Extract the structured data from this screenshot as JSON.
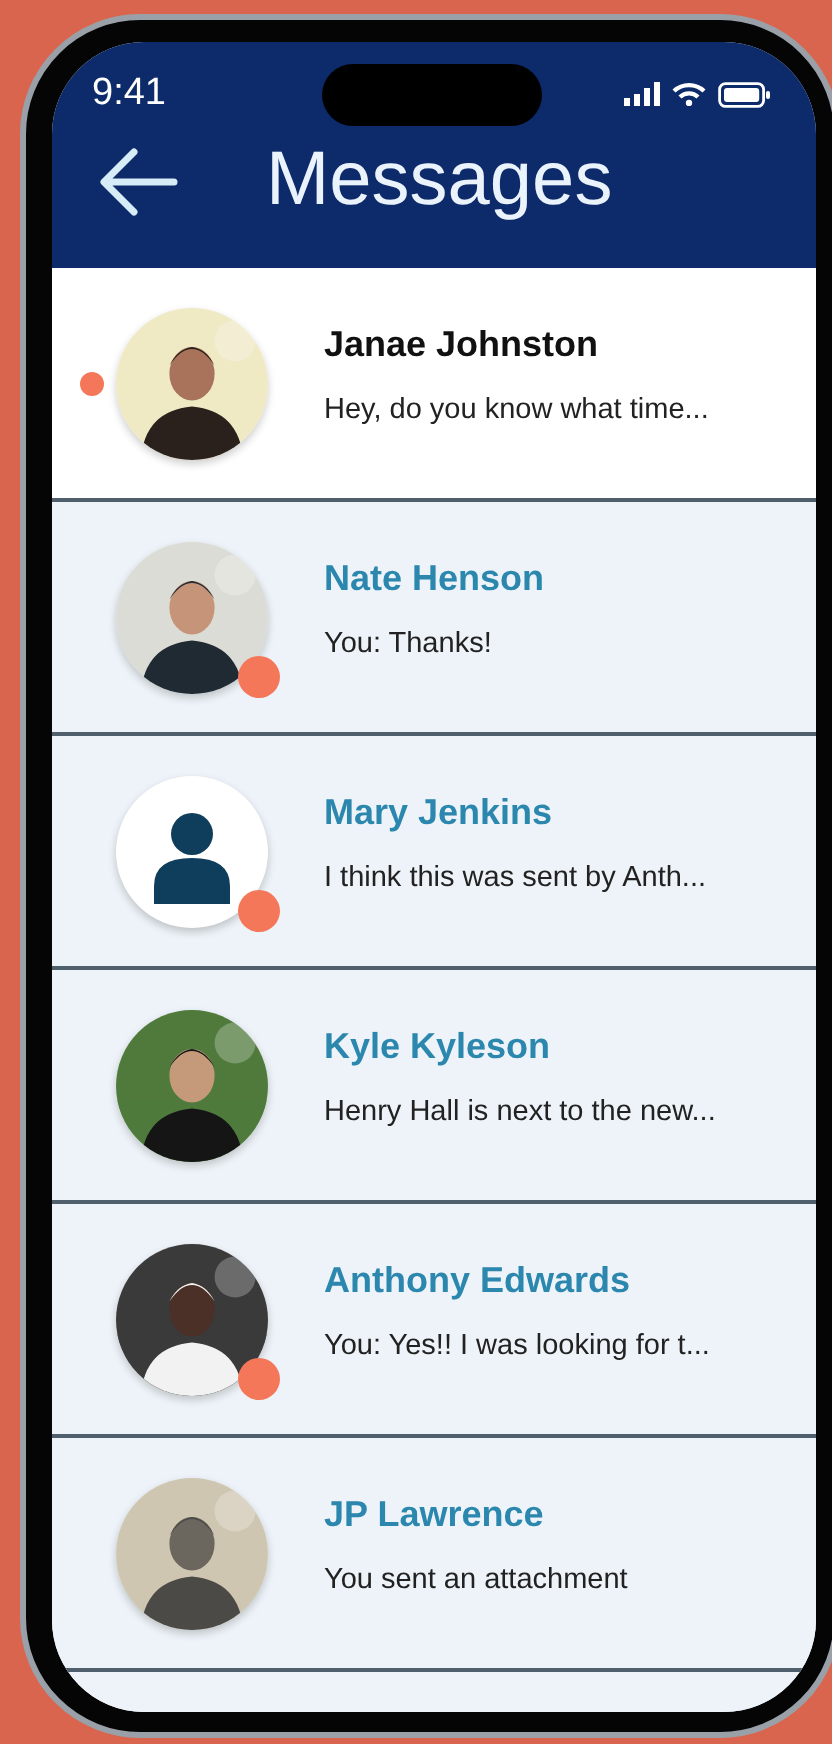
{
  "status_bar": {
    "time": "9:41"
  },
  "header": {
    "title": "Messages"
  },
  "conversations": [
    {
      "name": "Janae Johnston",
      "preview": "Hey, do you know what time...",
      "selected": true,
      "unread": true,
      "online": false
    },
    {
      "name": "Nate Henson",
      "preview": "You: Thanks!",
      "selected": false,
      "unread": false,
      "online": true
    },
    {
      "name": "Mary Jenkins",
      "preview": "I think this was sent by Anth...",
      "selected": false,
      "unread": false,
      "online": true,
      "avatar": {
        "kind": "placeholder"
      }
    },
    {
      "name": "Kyle Kyleson",
      "preview": "Henry Hall is next to the new...",
      "selected": false,
      "unread": false,
      "online": false
    },
    {
      "name": "Anthony Edwards",
      "preview": "You: Yes!! I was looking for t...",
      "selected": false,
      "unread": false,
      "online": true
    },
    {
      "name": "JP Lawrence",
      "preview": "You sent an attachment",
      "selected": false,
      "unread": false,
      "online": false
    }
  ]
}
